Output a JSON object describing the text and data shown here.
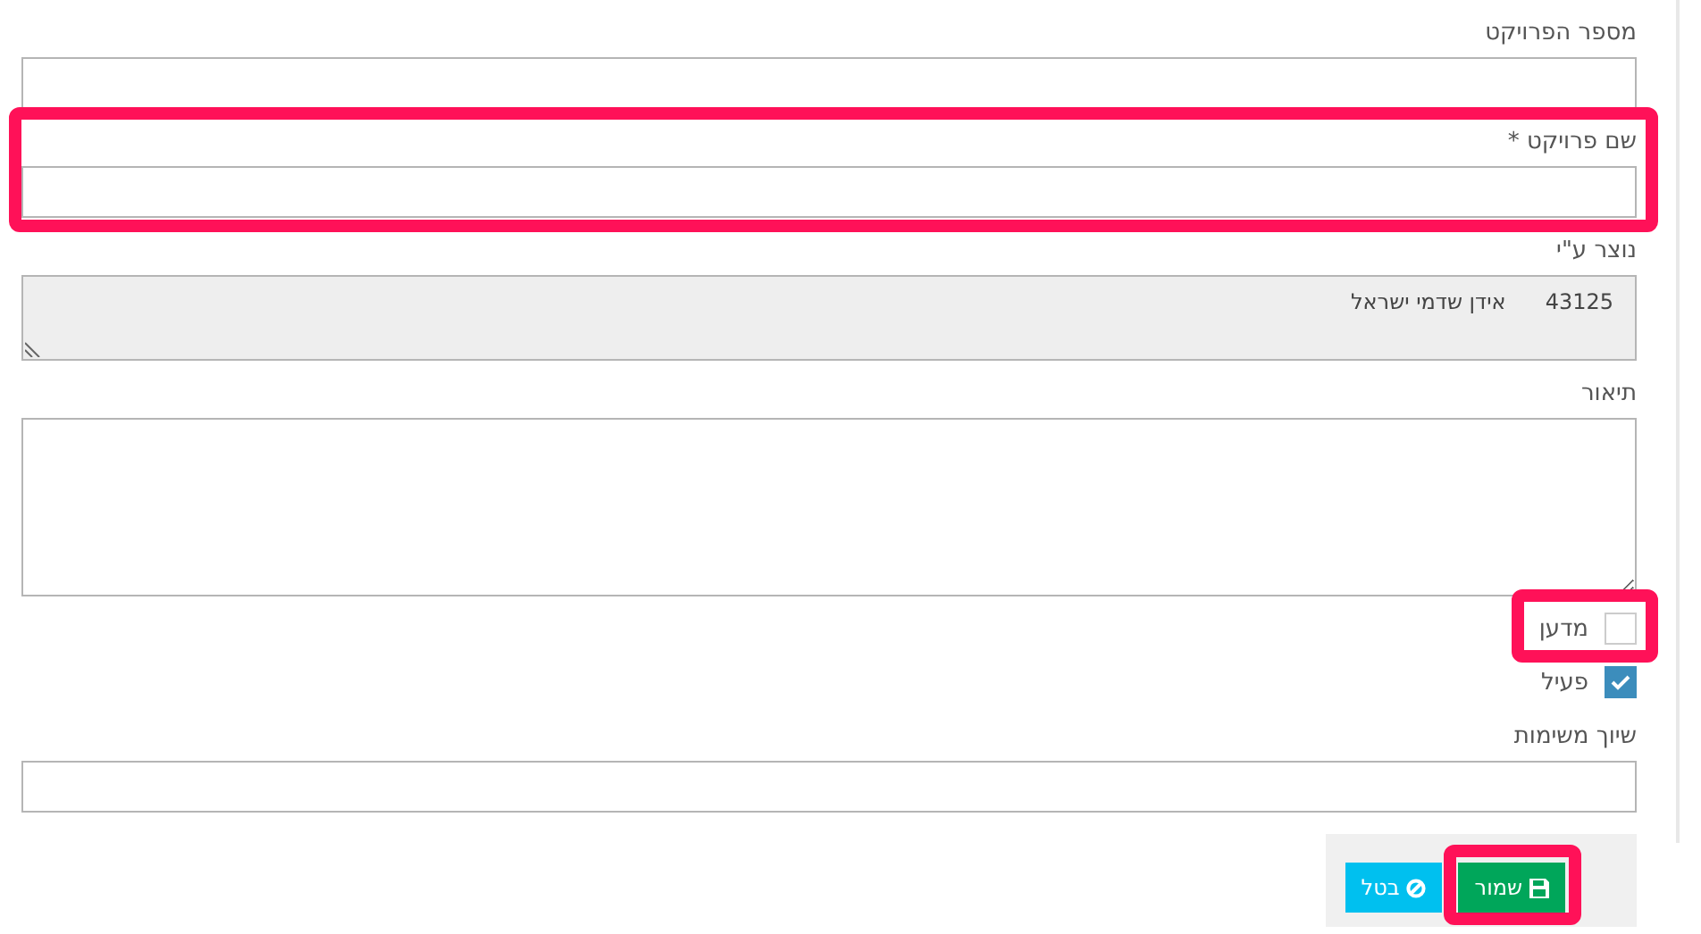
{
  "fields": [
    {
      "kind": "input",
      "label": "מספר הפרויקט",
      "highlighted": false
    },
    {
      "kind": "input",
      "label": "שם פרויקט *",
      "highlighted": true
    },
    {
      "kind": "readonly",
      "label": "נוצר ע\"י",
      "code": "43125",
      "value": "אידן שדמי ישראל",
      "highlighted": false
    },
    {
      "kind": "textarea",
      "label": "תיאור",
      "highlighted": false
    },
    {
      "kind": "checkbox",
      "label": "מדען",
      "checked": false,
      "highlighted": true
    },
    {
      "kind": "checkbox",
      "label": "פעיל",
      "checked": true,
      "highlighted": false
    },
    {
      "kind": "input",
      "label": "שיוך משימות",
      "highlighted": false
    }
  ],
  "buttons": [
    {
      "kind": "save",
      "label": "שמור",
      "highlighted": true
    },
    {
      "kind": "cancel",
      "label": "בטל",
      "highlighted": false
    }
  ]
}
